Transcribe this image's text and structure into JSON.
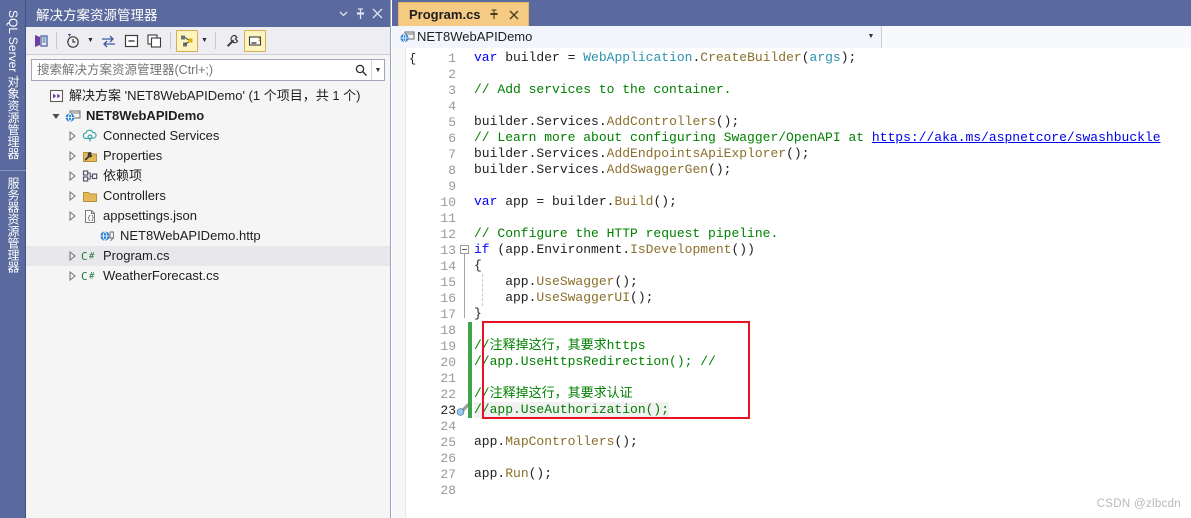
{
  "dock": {
    "tabs": [
      {
        "label": "SQL Server 对象资源管理器",
        "name": "sql-server-object-explorer-tab"
      },
      {
        "label": "服务器资源管理器",
        "name": "server-explorer-tab"
      }
    ]
  },
  "solution_explorer": {
    "title": "解决方案资源管理器",
    "title_buttons": [
      {
        "name": "panel-dropdown-icon",
        "glyph": "▾"
      },
      {
        "name": "pin-icon",
        "glyph": "⁜"
      },
      {
        "name": "close-icon",
        "glyph": "✕"
      }
    ],
    "toolbar": [
      {
        "name": "home-icon",
        "selected": false
      },
      {
        "name": "pending-changes-clock-icon",
        "selected": false,
        "has_caret": true
      },
      {
        "name": "sync-with-active-document-icon",
        "selected": false
      },
      {
        "name": "collapse-all-icon",
        "selected": false
      },
      {
        "name": "show-all-files-icon",
        "selected": false
      },
      {
        "name": "view-designer-icon",
        "selected": true,
        "has_caret": true
      },
      {
        "name": "properties-wrench-icon",
        "selected": false
      },
      {
        "name": "preview-selected-items-icon",
        "selected": true
      }
    ],
    "search": {
      "placeholder": "搜索解决方案资源管理器(Ctrl+;)",
      "value": ""
    },
    "tree": [
      {
        "label": "解决方案 'NET8WebAPIDemo' (1 个项目，共 1 个)",
        "indent": 0,
        "icon": "solution-icon",
        "expander": "none",
        "bold": false,
        "selected": false
      },
      {
        "label": "NET8WebAPIDemo",
        "indent": 1,
        "icon": "project-web-icon",
        "expander": "open",
        "bold": true,
        "selected": false
      },
      {
        "label": "Connected Services",
        "indent": 2,
        "icon": "connected-services-icon",
        "expander": "closed",
        "bold": false,
        "selected": false
      },
      {
        "label": "Properties",
        "indent": 2,
        "icon": "properties-folder-icon",
        "expander": "closed",
        "bold": false,
        "selected": false
      },
      {
        "label": "依赖项",
        "indent": 2,
        "icon": "dependencies-icon",
        "expander": "closed",
        "bold": false,
        "selected": false
      },
      {
        "label": "Controllers",
        "indent": 2,
        "icon": "folder-icon",
        "expander": "closed",
        "bold": false,
        "selected": false
      },
      {
        "label": "appsettings.json",
        "indent": 2,
        "icon": "json-file-icon",
        "expander": "closed",
        "bold": false,
        "selected": false
      },
      {
        "label": "NET8WebAPIDemo.http",
        "indent": 3,
        "icon": "http-file-icon",
        "expander": "none",
        "bold": false,
        "selected": false
      },
      {
        "label": "Program.cs",
        "indent": 2,
        "icon": "csharp-file-icon",
        "expander": "closed",
        "bold": false,
        "selected": true
      },
      {
        "label": "WeatherForecast.cs",
        "indent": 2,
        "icon": "csharp-file-icon",
        "expander": "closed",
        "bold": false,
        "selected": false
      }
    ]
  },
  "editor": {
    "tab": {
      "label": "Program.cs",
      "pin_glyph": "⁜",
      "close_glyph": "✕"
    },
    "navbar": {
      "project": "NET8WebAPIDemo",
      "caret": "▾"
    },
    "code": {
      "lines": [
        {
          "n": 1,
          "tokens": [
            {
              "t": "var",
              "c": "kw"
            },
            {
              "t": " builder ",
              "c": "idn"
            },
            {
              "t": "=",
              "c": "pun"
            },
            {
              "t": " ",
              "c": "idn"
            },
            {
              "t": "WebApplication",
              "c": "typ"
            },
            {
              "t": ".",
              "c": "pun"
            },
            {
              "t": "CreateBuilder",
              "c": "mth"
            },
            {
              "t": "(",
              "c": "pun"
            },
            {
              "t": "args",
              "c": "typ"
            },
            {
              "t": ");",
              "c": "pun"
            }
          ]
        },
        {
          "n": 2,
          "tokens": []
        },
        {
          "n": 3,
          "tokens": [
            {
              "t": "// Add services to the container.",
              "c": "cmt"
            }
          ]
        },
        {
          "n": 4,
          "tokens": []
        },
        {
          "n": 5,
          "tokens": [
            {
              "t": "builder",
              "c": "idn"
            },
            {
              "t": ".",
              "c": "pun"
            },
            {
              "t": "Services",
              "c": "idn"
            },
            {
              "t": ".",
              "c": "pun"
            },
            {
              "t": "AddControllers",
              "c": "mth"
            },
            {
              "t": "();",
              "c": "pun"
            }
          ]
        },
        {
          "n": 6,
          "tokens": [
            {
              "t": "// Learn more about configuring Swagger/OpenAPI at ",
              "c": "cmt"
            },
            {
              "t": "https://aka.ms/aspnetcore/swashbuckle",
              "c": "lnk"
            }
          ]
        },
        {
          "n": 7,
          "tokens": [
            {
              "t": "builder",
              "c": "idn"
            },
            {
              "t": ".",
              "c": "pun"
            },
            {
              "t": "Services",
              "c": "idn"
            },
            {
              "t": ".",
              "c": "pun"
            },
            {
              "t": "AddEndpointsApiExplorer",
              "c": "mth"
            },
            {
              "t": "();",
              "c": "pun"
            }
          ]
        },
        {
          "n": 8,
          "tokens": [
            {
              "t": "builder",
              "c": "idn"
            },
            {
              "t": ".",
              "c": "pun"
            },
            {
              "t": "Services",
              "c": "idn"
            },
            {
              "t": ".",
              "c": "pun"
            },
            {
              "t": "AddSwaggerGen",
              "c": "mth"
            },
            {
              "t": "();",
              "c": "pun"
            }
          ]
        },
        {
          "n": 9,
          "tokens": []
        },
        {
          "n": 10,
          "tokens": [
            {
              "t": "var",
              "c": "kw"
            },
            {
              "t": " app ",
              "c": "idn"
            },
            {
              "t": "=",
              "c": "pun"
            },
            {
              "t": " builder",
              "c": "idn"
            },
            {
              "t": ".",
              "c": "pun"
            },
            {
              "t": "Build",
              "c": "mth"
            },
            {
              "t": "();",
              "c": "pun"
            }
          ]
        },
        {
          "n": 11,
          "tokens": []
        },
        {
          "n": 12,
          "tokens": [
            {
              "t": "// Configure the HTTP request pipeline.",
              "c": "cmt"
            }
          ]
        },
        {
          "n": 13,
          "tokens": [
            {
              "t": "if",
              "c": "kw"
            },
            {
              "t": " (app",
              "c": "idn"
            },
            {
              "t": ".",
              "c": "pun"
            },
            {
              "t": "Environment",
              "c": "idn"
            },
            {
              "t": ".",
              "c": "pun"
            },
            {
              "t": "IsDevelopment",
              "c": "mth"
            },
            {
              "t": "())",
              "c": "pun"
            }
          ]
        },
        {
          "n": 14,
          "tokens": [
            {
              "t": "{",
              "c": "pun"
            }
          ]
        },
        {
          "n": 15,
          "tokens": [
            {
              "t": "    app",
              "c": "idn"
            },
            {
              "t": ".",
              "c": "pun"
            },
            {
              "t": "UseSwagger",
              "c": "mth"
            },
            {
              "t": "();",
              "c": "pun"
            }
          ]
        },
        {
          "n": 16,
          "tokens": [
            {
              "t": "    app",
              "c": "idn"
            },
            {
              "t": ".",
              "c": "pun"
            },
            {
              "t": "UseSwaggerUI",
              "c": "mth"
            },
            {
              "t": "();",
              "c": "pun"
            }
          ]
        },
        {
          "n": 17,
          "tokens": [
            {
              "t": "}",
              "c": "pun"
            }
          ]
        },
        {
          "n": 18,
          "tokens": []
        },
        {
          "n": 19,
          "tokens": [
            {
              "t": "//注释掉这行，其要求https",
              "c": "cmt"
            }
          ]
        },
        {
          "n": 20,
          "tokens": [
            {
              "t": "//app.UseHttpsRedirection(); //",
              "c": "cmt"
            }
          ]
        },
        {
          "n": 21,
          "tokens": []
        },
        {
          "n": 22,
          "tokens": [
            {
              "t": "//注释掉这行，其要求认证",
              "c": "cmt"
            }
          ]
        },
        {
          "n": 23,
          "tokens": [
            {
              "t": "//app.UseAuthorization();",
              "c": "cmt"
            }
          ],
          "current": true
        },
        {
          "n": 24,
          "tokens": []
        },
        {
          "n": 25,
          "tokens": [
            {
              "t": "app",
              "c": "idn"
            },
            {
              "t": ".",
              "c": "pun"
            },
            {
              "t": "MapControllers",
              "c": "mth"
            },
            {
              "t": "();",
              "c": "pun"
            }
          ]
        },
        {
          "n": 26,
          "tokens": []
        },
        {
          "n": 27,
          "tokens": [
            {
              "t": "app",
              "c": "idn"
            },
            {
              "t": ".",
              "c": "pun"
            },
            {
              "t": "Run",
              "c": "mth"
            },
            {
              "t": "();",
              "c": "pun"
            }
          ]
        },
        {
          "n": 28,
          "tokens": []
        }
      ],
      "annotation": {
        "name": "red-highlight-box",
        "color": "#e81123",
        "covers_lines": "18-23"
      },
      "change_bar": {
        "color": "#3fa54a",
        "covers_lines": "18-23"
      },
      "quick_action_line": 23
    }
  },
  "watermark": "CSDN @zlbcdn",
  "colors": {
    "chrome": "#5b6a9e",
    "active_tab": "#f5cb84",
    "selection": "#e8e8ec",
    "comment": "#008000",
    "keyword": "#0000ff",
    "type": "#2b91af",
    "method": "#8b6f2a",
    "link": "#0000ee",
    "annotation": "#e81123"
  }
}
